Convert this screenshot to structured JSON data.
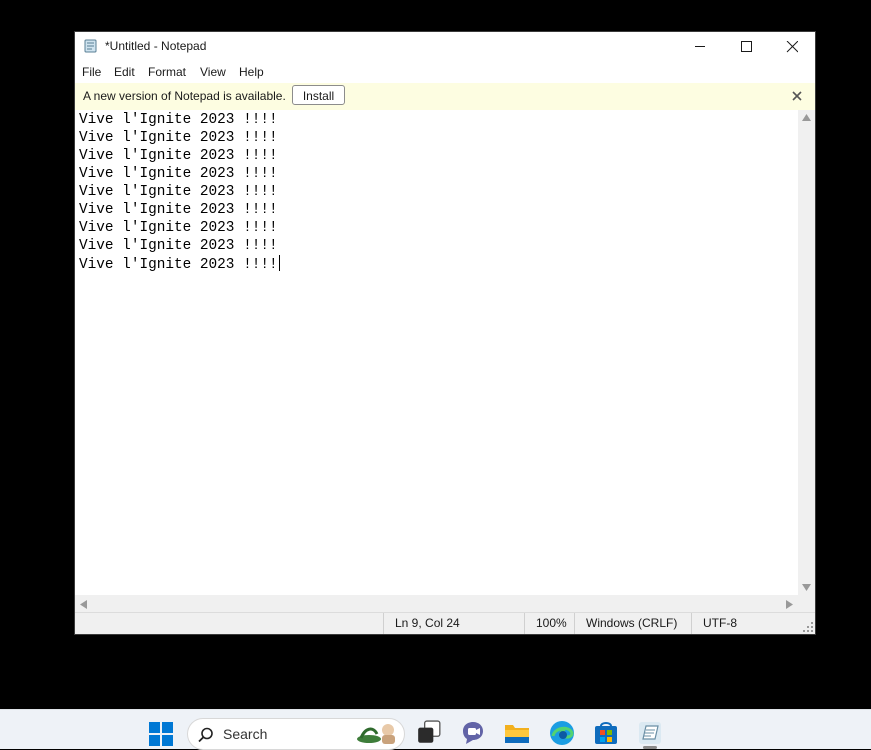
{
  "window": {
    "title": "*Untitled - Notepad"
  },
  "menu": [
    "File",
    "Edit",
    "Format",
    "View",
    "Help"
  ],
  "infobar": {
    "message": "A new version of Notepad is available.",
    "install_label": "Install"
  },
  "editor": {
    "lines": [
      "Vive l'Ignite 2023 !!!!",
      "Vive l'Ignite 2023 !!!!",
      "Vive l'Ignite 2023 !!!!",
      "Vive l'Ignite 2023 !!!!",
      "Vive l'Ignite 2023 !!!!",
      "Vive l'Ignite 2023 !!!!",
      "Vive l'Ignite 2023 !!!!",
      "Vive l'Ignite 2023 !!!!",
      "Vive l'Ignite 2023 !!!!"
    ]
  },
  "status": {
    "position": "Ln 9, Col 24",
    "zoom": "100%",
    "line_ending": "Windows (CRLF)",
    "encoding": "UTF-8"
  },
  "taskbar": {
    "search_label": "Search",
    "icons": [
      "start-icon",
      "search-icon",
      "task-view-icon",
      "teams-chat-icon",
      "file-explorer-icon",
      "edge-icon",
      "store-icon",
      "notepad-icon"
    ]
  },
  "colors": {
    "infobar_bg": "#fdfde1",
    "taskbar_bg": "#eef2f7",
    "windows_blue": "#0078d4"
  }
}
